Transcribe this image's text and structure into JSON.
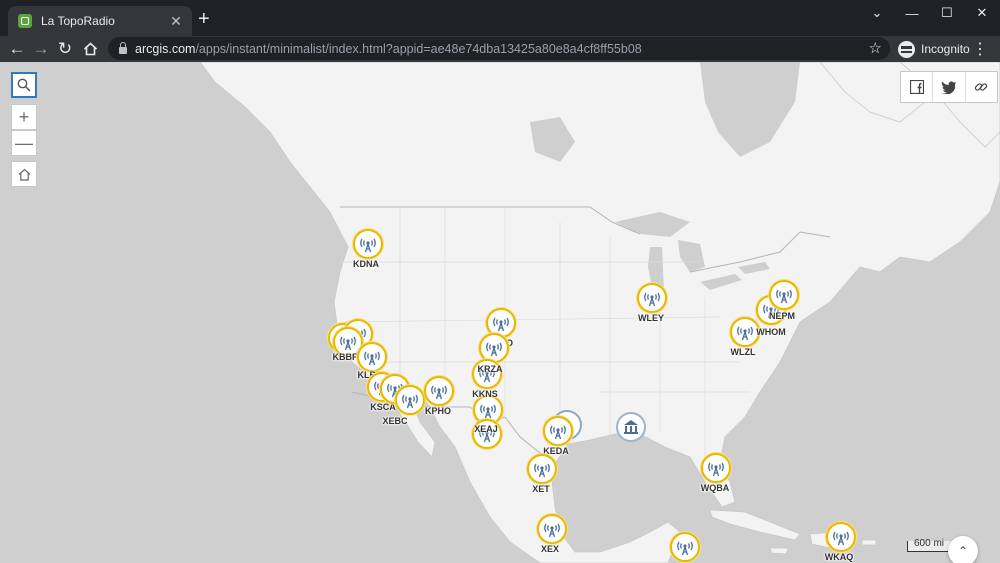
{
  "browser": {
    "tab_title": "La TopoRadio",
    "url_host": "arcgis.com",
    "url_path": "/apps/instant/minimalist/index.html?appid=ae48e74dba13425a80e8a4cf8ff55b08",
    "profile_label": "Incognito",
    "icons": {
      "back": "arrow-left-icon",
      "forward": "arrow-right-icon",
      "reload": "reload-icon",
      "home": "home-icon",
      "bookmark": "star-icon",
      "menu": "kebab-menu-icon"
    }
  },
  "map": {
    "tools": [
      "search-icon",
      "zoom-in-icon",
      "zoom-out-icon",
      "home-icon"
    ],
    "share": [
      "facebook-icon",
      "twitter-icon",
      "link-icon"
    ],
    "scale_label": "600 mi",
    "colors": {
      "land": "#f3f3f3",
      "water": "#cfcfd0",
      "marker_ring": "#e8b800",
      "marker_icon": "#4a6f9c"
    },
    "stations": [
      {
        "label": "KDNA",
        "labeled": true
      },
      {
        "label": "",
        "labeled": false
      },
      {
        "label": "",
        "labeled": false
      },
      {
        "label": "KBBF",
        "labeled": true
      },
      {
        "label": "KLBN",
        "labeled": true
      },
      {
        "label": "KSCA",
        "labeled": true
      },
      {
        "label": "",
        "labeled": false
      },
      {
        "label": "XEBC",
        "labeled": true
      },
      {
        "label": "KPHO",
        "labeled": true
      },
      {
        "label": "KUVO",
        "labeled": true
      },
      {
        "label": "",
        "labeled": false
      },
      {
        "label": "KRZA",
        "labeled": true
      },
      {
        "label": "KKNS",
        "labeled": true
      },
      {
        "label": "XEAJ",
        "labeled": true
      },
      {
        "label": "KEDA",
        "labeled": true
      },
      {
        "label": "XET",
        "labeled": true
      },
      {
        "label": "XEX",
        "labeled": true
      },
      {
        "label": "WLEY",
        "labeled": true
      },
      {
        "label": "WLZL",
        "labeled": true
      },
      {
        "label": "WHOM",
        "labeled": true
      },
      {
        "label": "NEPM",
        "labeled": true
      },
      {
        "label": "WQBA",
        "labeled": true
      },
      {
        "label": "WKAQ",
        "labeled": true
      },
      {
        "label": "",
        "labeled": false
      }
    ],
    "other_markers": [
      "museum-icon",
      "radio-tower-icon"
    ]
  }
}
